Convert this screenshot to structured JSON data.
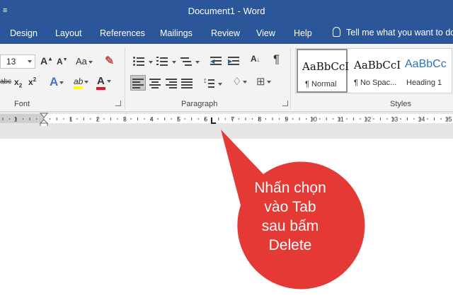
{
  "window": {
    "title": "Document1  -  Word",
    "qat_icon": "customize-quick-access-dropdown"
  },
  "tabs": [
    "Design",
    "Layout",
    "References",
    "Mailings",
    "Review",
    "View",
    "Help"
  ],
  "tell_me": "Tell me what you want to do",
  "font_group": {
    "font_size": "13",
    "grow_font": "A",
    "shrink_font": "A",
    "change_case": "Aa",
    "strikethrough": "abc",
    "subscript": "x",
    "superscript": "x",
    "text_effects": "A",
    "text_highlight": "ab",
    "font_color": "A",
    "label": "Font"
  },
  "paragraph_group": {
    "label": "Paragraph"
  },
  "styles_group": {
    "label": "Styles",
    "items": [
      {
        "sample": "AaBbCcI",
        "name": "¶ Normal"
      },
      {
        "sample": "AaBbCcI",
        "name": "¶ No Spac..."
      },
      {
        "sample": "AaBbCc",
        "name": "Heading 1"
      }
    ]
  },
  "ruler": {
    "numbers": [
      "1",
      "1",
      "2",
      "3",
      "4",
      "5",
      "6",
      "7",
      "8",
      "9",
      "10",
      "11",
      "12",
      "13",
      "14",
      "15"
    ]
  },
  "callout": {
    "lines": [
      "Nhấn chọn",
      "vào Tab",
      "sau bấm",
      "Delete"
    ]
  },
  "colors": {
    "accent": "#2b579a",
    "ribbon_bg": "#f3f3f3",
    "highlight_yellow": "#ffff00",
    "font_color_red": "#e81123",
    "heading_blue": "#2e74b5",
    "callout_red": "#e53935"
  }
}
